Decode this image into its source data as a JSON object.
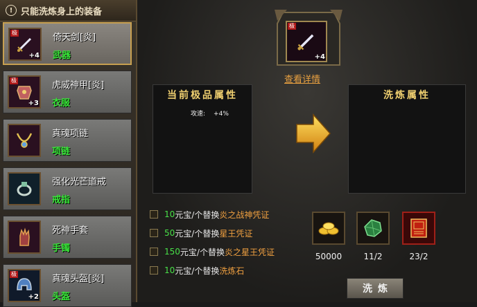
{
  "sidebar": {
    "header": "只能洗炼身上的装备",
    "items": [
      {
        "name": "倚天剑[炎]",
        "type": "武器",
        "badge": "极",
        "plus": "+4",
        "icon": "sword-icon",
        "selected": true
      },
      {
        "name": "虎威神甲[炎]",
        "type": "衣服",
        "badge": "极",
        "plus": "+3",
        "icon": "armor-icon",
        "selected": false
      },
      {
        "name": "真魂项链",
        "type": "项链",
        "badge": "",
        "plus": "",
        "icon": "necklace-icon",
        "selected": false
      },
      {
        "name": "强化光芒道戒",
        "type": "戒指",
        "badge": "",
        "plus": "",
        "icon": "ring-icon",
        "selected": false
      },
      {
        "name": "死神手套",
        "type": "手镯",
        "badge": "",
        "plus": "",
        "icon": "glove-icon",
        "selected": false
      },
      {
        "name": "真魂头盔[炎]",
        "type": "头盔",
        "badge": "极",
        "plus": "+2",
        "icon": "helmet-icon",
        "selected": false
      }
    ]
  },
  "center": {
    "badge": "极",
    "plus": "+4",
    "icon": "sword-icon",
    "detail_link": "查看详情"
  },
  "current_panel": {
    "title": "当前极品属性",
    "attr_label": "攻速:",
    "attr_value": "+4%"
  },
  "refine_panel": {
    "title": "洗炼属性"
  },
  "options": [
    {
      "amount": "10",
      "text": "元宝/个替换",
      "item": "炎之战神凭证"
    },
    {
      "amount": "50",
      "text": "元宝/个替换",
      "item": "星王凭证"
    },
    {
      "amount": "150",
      "text": "元宝/个替换",
      "item": "炎之星王凭证"
    },
    {
      "amount": "10",
      "text": "元宝/个替换",
      "item": "洗炼石"
    }
  ],
  "materials": [
    {
      "icon": "gold-ingot-icon",
      "count": "50000"
    },
    {
      "icon": "green-stone-icon",
      "count": "11/2"
    },
    {
      "icon": "red-certificate-icon",
      "count": "23/2"
    }
  ],
  "refine_button": "洗炼",
  "colors": {
    "accent_gold": "#f0d070",
    "green": "#48e048",
    "orange": "#f0a040"
  }
}
